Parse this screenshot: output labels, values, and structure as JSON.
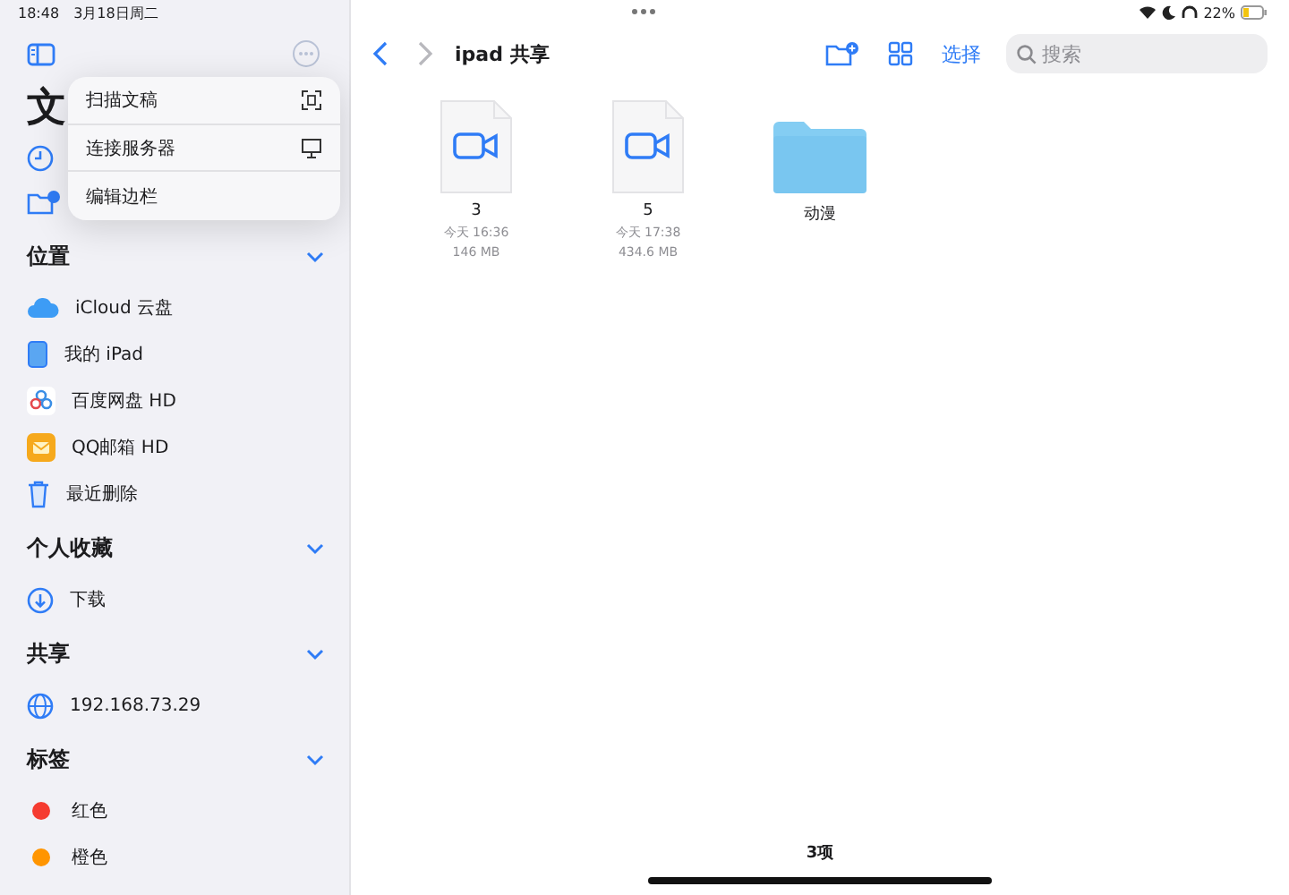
{
  "status_bar": {
    "time": "18:48",
    "date": "3月18日周二",
    "battery": "22%"
  },
  "sidebar": {
    "title": "文",
    "sections": [
      {
        "title": "位置",
        "expanded": true,
        "items": [
          {
            "label": "iCloud 云盘"
          },
          {
            "label": "我的 iPad"
          },
          {
            "label": "百度网盘 HD"
          },
          {
            "label": "QQ邮箱 HD"
          },
          {
            "label": "最近删除"
          }
        ]
      },
      {
        "title": "个人收藏",
        "expanded": true,
        "items": [
          {
            "label": "下载"
          }
        ]
      },
      {
        "title": "共享",
        "expanded": true,
        "items": [
          {
            "label": "192.168.73.29"
          }
        ]
      },
      {
        "title": "标签",
        "expanded": true,
        "items": [
          {
            "label": "红色",
            "color": "#f53b30"
          },
          {
            "label": "橙色",
            "color": "#ff9500"
          }
        ]
      }
    ]
  },
  "menu": {
    "items": [
      {
        "label": "扫描文稿"
      },
      {
        "label": "连接服务器"
      },
      {
        "label": "编辑边栏"
      }
    ]
  },
  "toolbar": {
    "title": "ipad 共享",
    "select": "选择",
    "search": {
      "placeholder": "搜索"
    }
  },
  "files": [
    {
      "kind": "video",
      "name": "3",
      "date": "今天 16:36",
      "size": "146 MB"
    },
    {
      "kind": "video",
      "name": "5",
      "date": "今天 17:38",
      "size": "434.6 MB"
    },
    {
      "kind": "folder",
      "name": "动漫"
    }
  ],
  "footer": {
    "count": "3项"
  }
}
